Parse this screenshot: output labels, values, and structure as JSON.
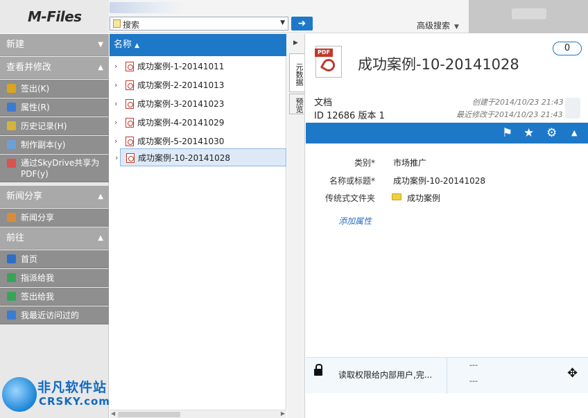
{
  "app": {
    "logo": "M-Files"
  },
  "search": {
    "placeholder": "搜索",
    "advanced_label": "高级搜索",
    "go_icon": "arrow-right-icon"
  },
  "sidebar": {
    "sections": [
      {
        "label": "新建"
      },
      {
        "label": "查看并修改"
      },
      {
        "label": "新闻分享"
      },
      {
        "label": "前往"
      }
    ],
    "items": [
      {
        "label": "签出(K)",
        "icon": "pencil-icon",
        "color": "#d9a520"
      },
      {
        "label": "属性(R)",
        "icon": "properties-icon",
        "color": "#3a7bd5"
      },
      {
        "label": "历史记录(H)",
        "icon": "history-icon",
        "color": "#d4b53a"
      },
      {
        "label": "制作副本(y)",
        "icon": "copy-icon",
        "color": "#6f9fd8"
      },
      {
        "label": "通过SkyDrive共享为PDF(y)",
        "icon": "share-pdf-icon",
        "color": "#d9534f"
      },
      {
        "label": "新闻分享",
        "icon": "news-share-icon",
        "color": "#d98c3a"
      },
      {
        "label": "首页",
        "icon": "home-icon",
        "color": "#2d6fc8"
      },
      {
        "label": "指派给我",
        "icon": "assigned-icon",
        "color": "#3aa35a"
      },
      {
        "label": "签出给我",
        "icon": "checked-out-icon",
        "color": "#3aa35a"
      },
      {
        "label": "我最近访问过的",
        "icon": "recent-icon",
        "color": "#3a7bd5"
      }
    ]
  },
  "list": {
    "header": "名称",
    "rows": [
      {
        "name": "成功案例-1-20141011"
      },
      {
        "name": "成功案例-2-20141013"
      },
      {
        "name": "成功案例-3-20141023"
      },
      {
        "name": "成功案例-4-20141029"
      },
      {
        "name": "成功案例-5-20141030"
      },
      {
        "name": "成功案例-10-20141028",
        "selected": true
      }
    ]
  },
  "tabs": [
    {
      "label": "元数据"
    },
    {
      "label": "预览"
    }
  ],
  "details": {
    "title": "成功案例-10-20141028",
    "comment_count": "0",
    "doc_type": "文档",
    "doc_id": "ID 12686 版本 1",
    "created": "创建于2014/10/23 21:43",
    "modified": "最近修改于2014/10/23 21:43",
    "toolbar_icons": [
      "flag-icon",
      "star-icon",
      "gear-icon",
      "chevron-up-icon"
    ],
    "props": [
      {
        "label": "类别*",
        "value": "市场推广"
      },
      {
        "label": "名称或标题*",
        "value": "成功案例-10-20141028"
      },
      {
        "label": "传统式文件夹",
        "value": "成功案例"
      }
    ],
    "add_property": "添加属性",
    "permission": "读取权限给内部用户,完...",
    "footer_dash_1": "---",
    "footer_dash_2": "---"
  },
  "watermark": {
    "line1": "非凡软件站",
    "line2": "CRSKY.com"
  },
  "colors": {
    "accent": "#1e78c8",
    "sidebar_item": "#8f8f8f",
    "sidebar_section": "#a9a9a9"
  }
}
